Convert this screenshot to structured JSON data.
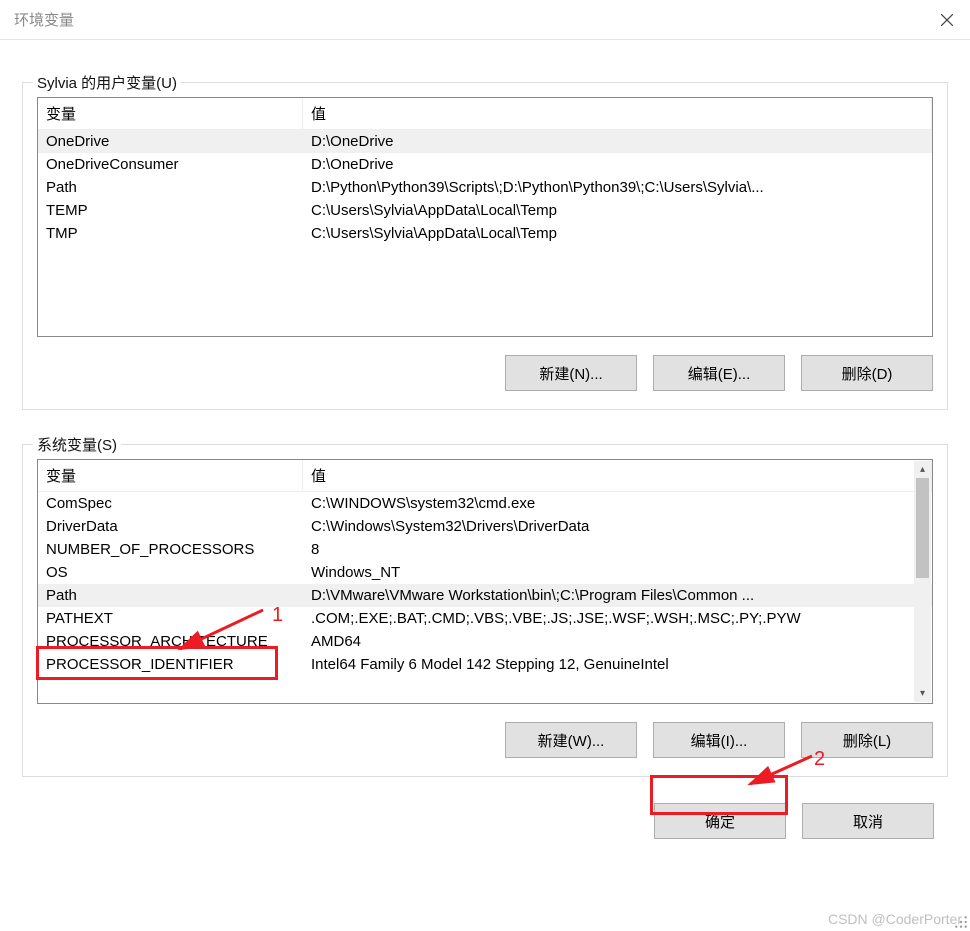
{
  "window": {
    "title": "环境变量"
  },
  "user_section": {
    "legend": "Sylvia 的用户变量(U)",
    "columns": {
      "var": "变量",
      "val": "值"
    },
    "rows": [
      {
        "var": "OneDrive",
        "val": "D:\\OneDrive",
        "selected": true
      },
      {
        "var": "OneDriveConsumer",
        "val": "D:\\OneDrive"
      },
      {
        "var": "Path",
        "val": "D:\\Python\\Python39\\Scripts\\;D:\\Python\\Python39\\;C:\\Users\\Sylvia\\..."
      },
      {
        "var": "TEMP",
        "val": "C:\\Users\\Sylvia\\AppData\\Local\\Temp"
      },
      {
        "var": "TMP",
        "val": "C:\\Users\\Sylvia\\AppData\\Local\\Temp"
      }
    ],
    "buttons": {
      "new": "新建(N)...",
      "edit": "编辑(E)...",
      "delete": "删除(D)"
    }
  },
  "system_section": {
    "legend": "系统变量(S)",
    "columns": {
      "var": "变量",
      "val": "值"
    },
    "rows": [
      {
        "var": "ComSpec",
        "val": "C:\\WINDOWS\\system32\\cmd.exe"
      },
      {
        "var": "DriverData",
        "val": "C:\\Windows\\System32\\Drivers\\DriverData"
      },
      {
        "var": "NUMBER_OF_PROCESSORS",
        "val": "8"
      },
      {
        "var": "OS",
        "val": "Windows_NT"
      },
      {
        "var": "Path",
        "val": "D:\\VMware\\VMware Workstation\\bin\\;C:\\Program Files\\Common ...",
        "selected": true
      },
      {
        "var": "PATHEXT",
        "val": ".COM;.EXE;.BAT;.CMD;.VBS;.VBE;.JS;.JSE;.WSF;.WSH;.MSC;.PY;.PYW"
      },
      {
        "var": "PROCESSOR_ARCHITECTURE",
        "val": "AMD64"
      },
      {
        "var": "PROCESSOR_IDENTIFIER",
        "val": "Intel64 Family 6 Model 142 Stepping 12, GenuineIntel"
      }
    ],
    "buttons": {
      "new": "新建(W)...",
      "edit": "编辑(I)...",
      "delete": "删除(L)"
    }
  },
  "dialog_buttons": {
    "ok": "确定",
    "cancel": "取消"
  },
  "annotations": {
    "label1": "1",
    "label2": "2"
  },
  "watermark": "CSDN @CoderPorter"
}
